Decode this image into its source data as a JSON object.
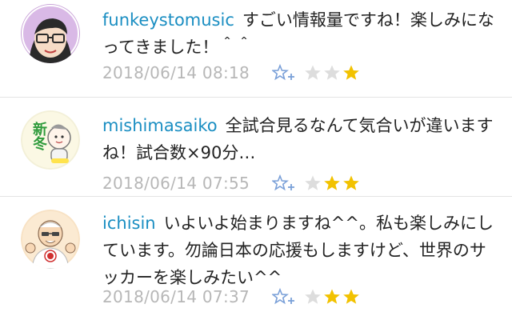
{
  "comments": [
    {
      "username": "funkeystomusic",
      "text": "すごい情報量ですね！楽しみになってきました！＾＾",
      "date": "2018/06/14 08:18",
      "rating": 1
    },
    {
      "username": "mishimasaiko",
      "text": "全試合見るなんて気合いが違いますね！試合数×90分…",
      "date": "2018/06/14 07:55",
      "rating": 2
    },
    {
      "username": "ichisin",
      "text": "いよいよ始まりますね^^。私も楽しみにしています。勿論日本の応援もしますけど、世界のサッカーを楽しみたい^^",
      "date": "2018/06/14 07:37",
      "rating": 2
    }
  ],
  "avatar2_text": "新冬",
  "colors": {
    "username": "#1a8ec2",
    "date": "#b7b7b7",
    "star_on": "#f2c200",
    "star_off": "#dddddd",
    "fav": "#7aa0d8"
  },
  "icons": {
    "fav": "star-plus-icon",
    "rating": "star-icon"
  }
}
